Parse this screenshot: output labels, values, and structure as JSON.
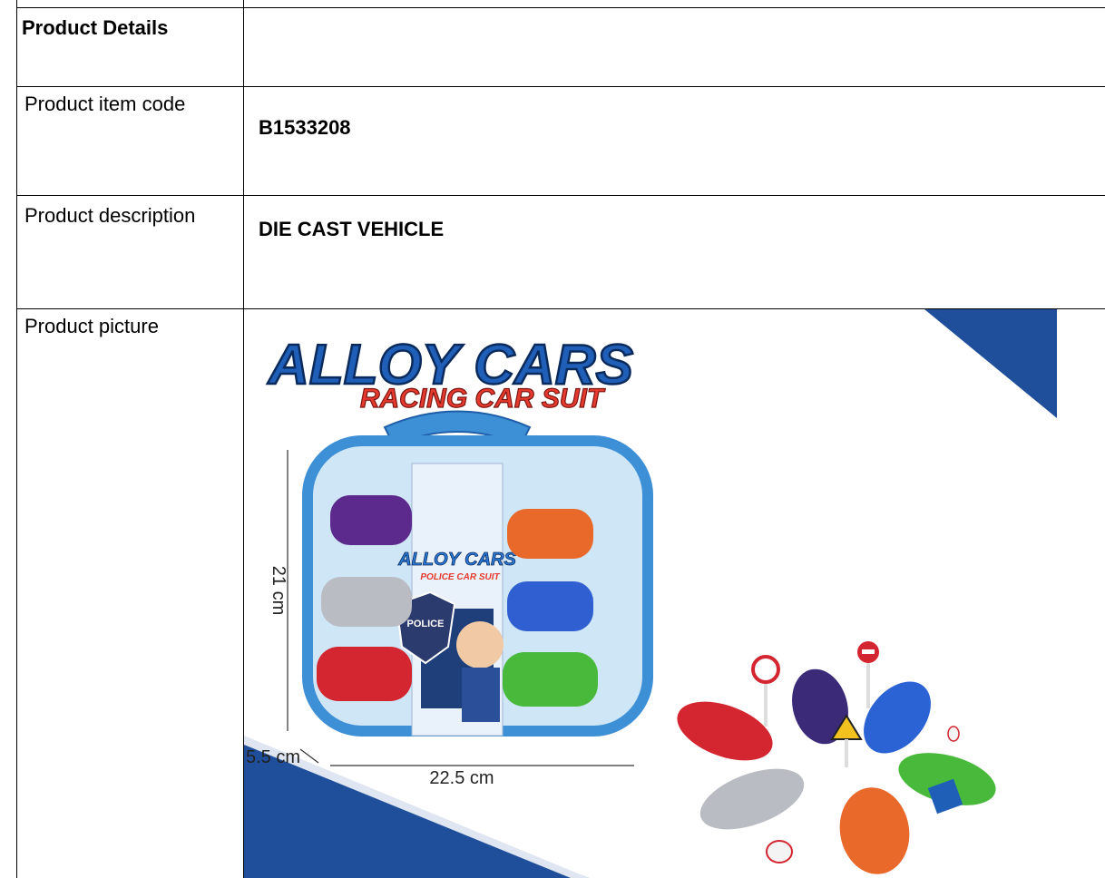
{
  "table": {
    "header_label": "Product Details",
    "rows": [
      {
        "label": "Product  item code",
        "value": "B1533208"
      },
      {
        "label": "Product  description",
        "value": "DIE CAST VEHICLE"
      },
      {
        "label": "Product  picture"
      }
    ]
  },
  "picture": {
    "brand_title": "ALLOY CARS",
    "brand_subtitle": "RACING CAR SUIT",
    "inner_title": "ALLOY CARS",
    "inner_subtitle": "POLICE CAR SUIT",
    "badge_text": "POLICE",
    "dimensions": {
      "height": "21 cm",
      "depth": "5.5 cm",
      "width": "22.5 cm"
    },
    "colors": {
      "accent_blue": "#1f4f9a",
      "case_blue": "#3d8fd6"
    }
  }
}
